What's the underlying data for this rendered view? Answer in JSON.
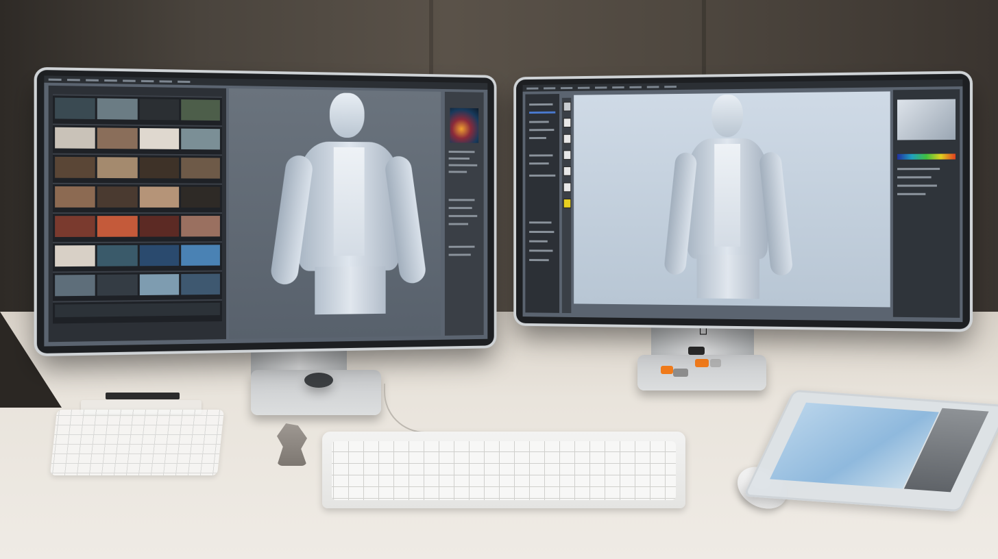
{
  "scene": {
    "colors": {
      "wall": "#4a443d",
      "desk": "#e9e4dc",
      "screen_ui": "#2c3036",
      "viewport": "#5b6470",
      "mannequin": "#c9d4df",
      "accent_orange": "#f07a1a"
    },
    "left_monitor": {
      "icons": [
        "apple-logo-icon"
      ],
      "filmstrip_rows": 8
    },
    "right_monitor": {
      "icons": [
        "apple-logo-icon"
      ]
    }
  }
}
